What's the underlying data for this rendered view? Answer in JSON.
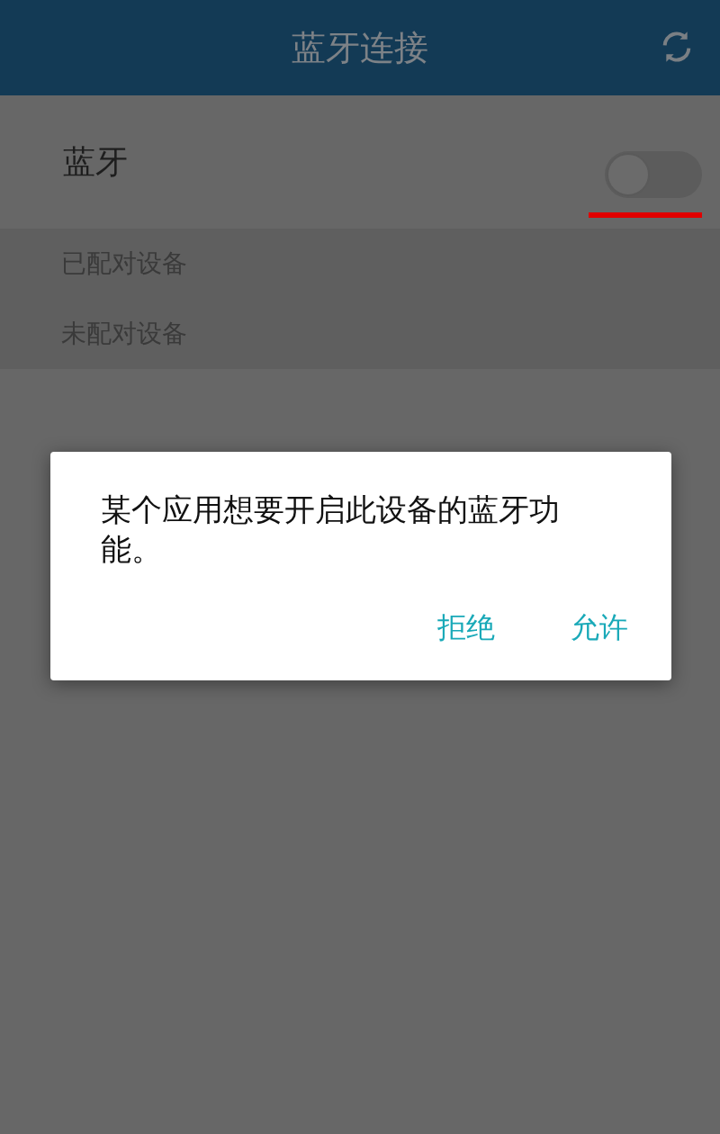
{
  "header": {
    "title": "蓝牙连接"
  },
  "bluetooth": {
    "label": "蓝牙",
    "on": false
  },
  "sections": [
    "已配对设备",
    "未配对设备"
  ],
  "dialog": {
    "message": "某个应用想要开启此设备的蓝牙功能。",
    "buttons": [
      "拒绝",
      "允许"
    ]
  }
}
